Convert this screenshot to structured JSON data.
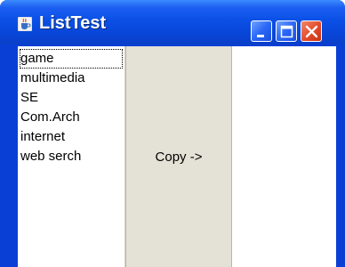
{
  "window": {
    "title": "ListTest",
    "app_icon": "java-coffee-cup-icon",
    "controls": [
      "minimize-icon",
      "maximize-icon",
      "close-icon"
    ]
  },
  "source_list": {
    "items": [
      "game",
      "multimedia",
      "SE",
      "Com.Arch",
      "internet",
      "web serch"
    ],
    "focused_index": 0
  },
  "copy_button": {
    "label": "Copy ->"
  },
  "target_list": {
    "items": []
  },
  "colors": {
    "titlebar": "#0846d8",
    "close_button": "#e2492a",
    "panel_background": "#ece9d8"
  }
}
